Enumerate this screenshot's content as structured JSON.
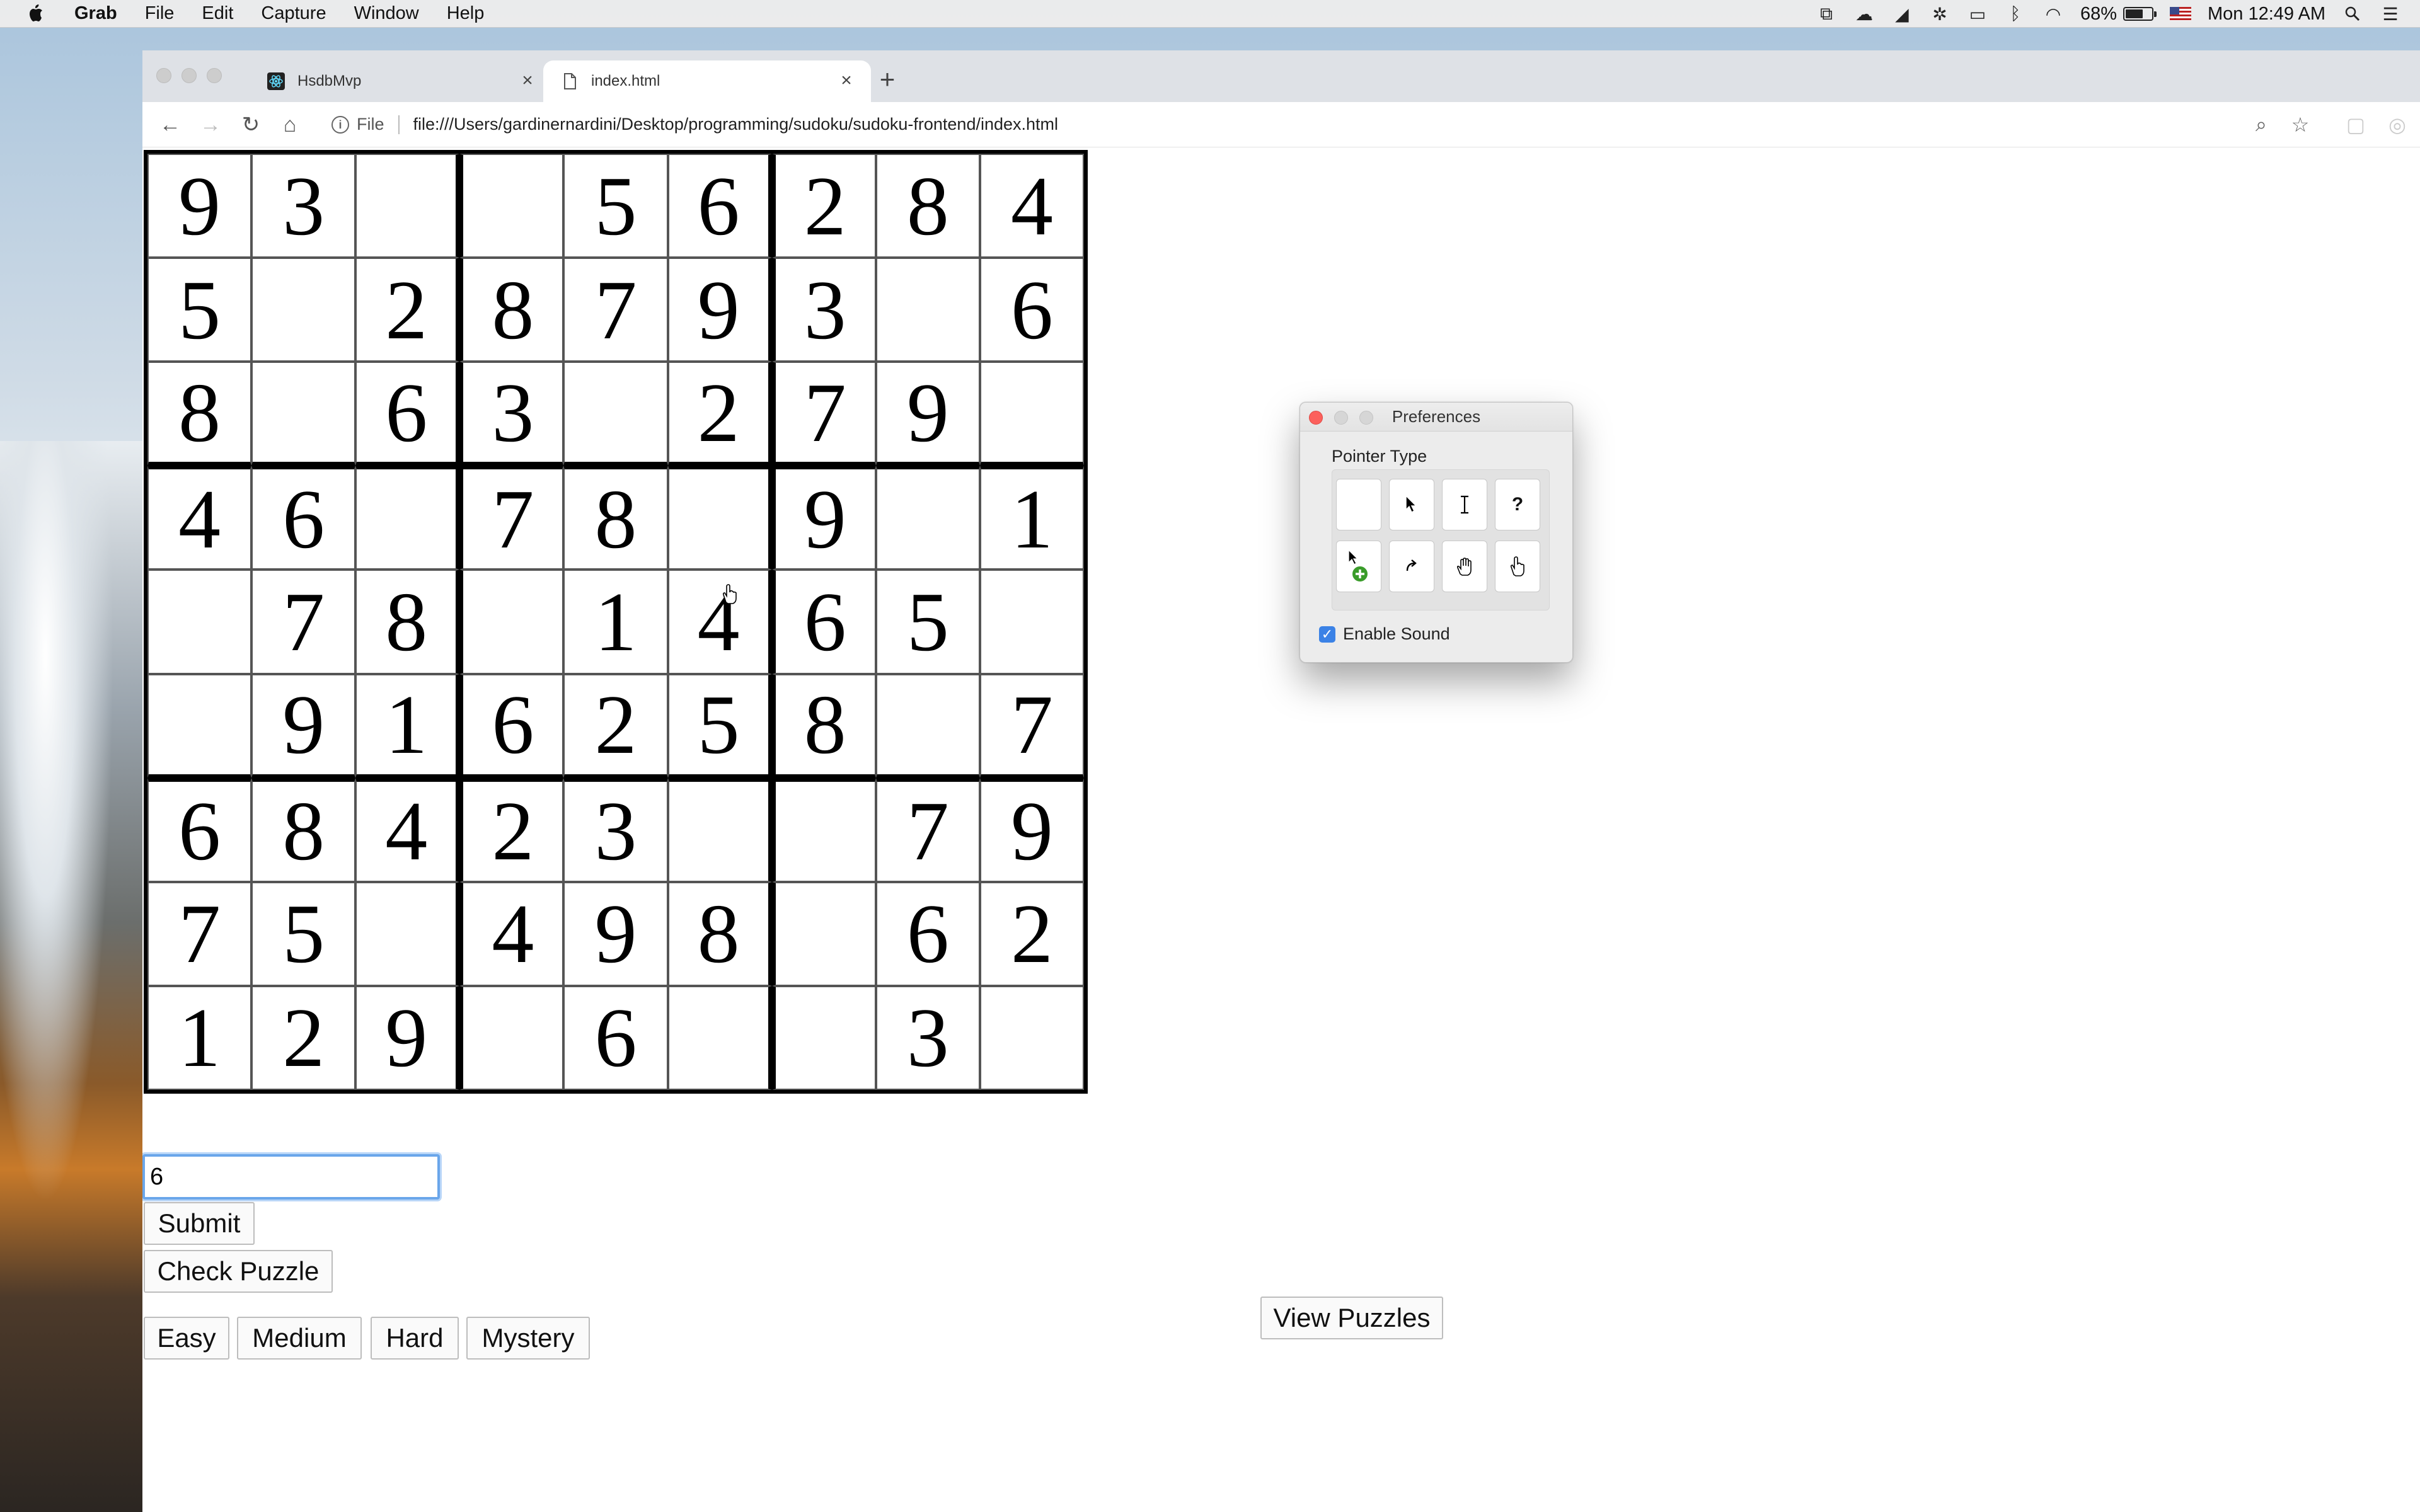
{
  "menubar": {
    "app_name": "Grab",
    "items": [
      "File",
      "Edit",
      "Capture",
      "Window",
      "Help"
    ],
    "battery_percent": "68%",
    "battery_level": 0.68,
    "clock": "Mon 12:49 AM"
  },
  "browser": {
    "tabs": [
      {
        "title": "HsdbMvp",
        "active": false
      },
      {
        "title": "index.html",
        "active": true
      }
    ],
    "url_scheme_label": "File",
    "url": "file:///Users/gardinernardini/Desktop/programming/sudoku/sudoku-frontend/index.html"
  },
  "sudoku": {
    "rows": [
      [
        "9",
        "3",
        "",
        "",
        "5",
        "6",
        "2",
        "8",
        "4"
      ],
      [
        "5",
        "",
        "2",
        "8",
        "7",
        "9",
        "3",
        "",
        "6"
      ],
      [
        "8",
        "",
        "6",
        "3",
        "",
        "2",
        "7",
        "9",
        ""
      ],
      [
        "4",
        "6",
        "",
        "7",
        "8",
        "",
        "9",
        "",
        "1"
      ],
      [
        "",
        "7",
        "8",
        "",
        "1",
        "4",
        "6",
        "5",
        ""
      ],
      [
        "",
        "9",
        "1",
        "6",
        "2",
        "5",
        "8",
        "",
        "7"
      ],
      [
        "6",
        "8",
        "4",
        "2",
        "3",
        "",
        "",
        "7",
        "9"
      ],
      [
        "7",
        "5",
        "",
        "4",
        "9",
        "8",
        "",
        "6",
        "2"
      ],
      [
        "1",
        "2",
        "9",
        "",
        "6",
        "",
        "",
        "3",
        ""
      ]
    ]
  },
  "controls": {
    "input_value": "6",
    "submit_label": "Submit",
    "check_label": "Check Puzzle",
    "view_label": "View Puzzles",
    "difficulty": [
      "Easy",
      "Medium",
      "Hard",
      "Mystery"
    ]
  },
  "preferences": {
    "title": "Preferences",
    "section_label": "Pointer Type",
    "pointer_icons": [
      "none",
      "arrow-pointer",
      "i-beam",
      "help-question",
      "copy-plus-arrow",
      "alias-arrow",
      "open-hand",
      "pointing-hand"
    ],
    "sound_label": "Enable Sound",
    "sound_enabled": true
  }
}
